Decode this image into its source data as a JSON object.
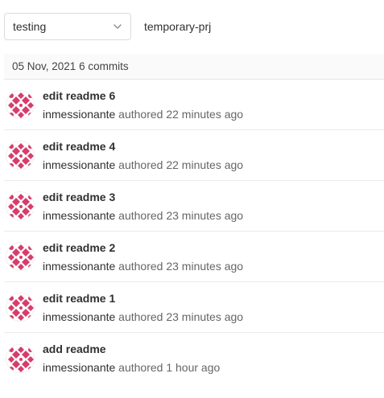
{
  "branch_selector": {
    "value": "testing"
  },
  "path": {
    "text": "temporary-prj"
  },
  "day_header": {
    "date": "05 Nov, 2021",
    "count": "6 commits"
  },
  "commits": [
    {
      "title": "edit readme 6",
      "author": "inmessionante",
      "action": "authored",
      "time": "22 minutes ago"
    },
    {
      "title": "edit readme 4",
      "author": "inmessionante",
      "action": "authored",
      "time": "22 minutes ago"
    },
    {
      "title": "edit readme 3",
      "author": "inmessionante",
      "action": "authored",
      "time": "23 minutes ago"
    },
    {
      "title": "edit readme 2",
      "author": "inmessionante",
      "action": "authored",
      "time": "23 minutes ago"
    },
    {
      "title": "edit readme 1",
      "author": "inmessionante",
      "action": "authored",
      "time": "23 minutes ago"
    },
    {
      "title": "add readme",
      "author": "inmessionante",
      "action": "authored",
      "time": "1 hour ago"
    }
  ],
  "icons": {
    "chevron": "chevron-down-icon",
    "avatar": "identicon-avatar"
  },
  "colors": {
    "avatar_accent": "#d63d6c",
    "border": "#dbdbdb",
    "header_bg": "#fafafa"
  }
}
